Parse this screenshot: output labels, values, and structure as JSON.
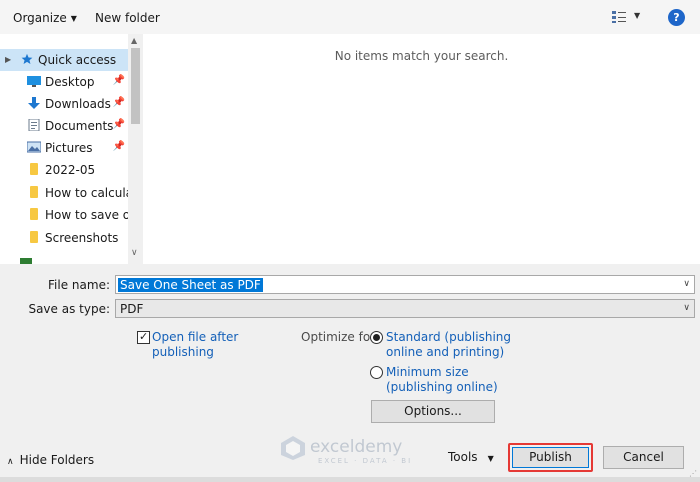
{
  "toolbar": {
    "organize_label": "Organize",
    "new_folder_label": "New folder",
    "help_label": "?"
  },
  "nav": {
    "items": [
      {
        "label": "Quick access",
        "icon": "star-icon"
      },
      {
        "label": "Desktop",
        "icon": "desktop-icon"
      },
      {
        "label": "Downloads",
        "icon": "download-arrow-icon"
      },
      {
        "label": "Documents",
        "icon": "documents-icon"
      },
      {
        "label": "Pictures",
        "icon": "pictures-icon"
      },
      {
        "label": "2022-05",
        "icon": "folder-icon"
      },
      {
        "label": "How to calculate",
        "icon": "folder-icon"
      },
      {
        "label": "How to save one",
        "icon": "folder-icon"
      },
      {
        "label": "Screenshots",
        "icon": "folder-icon"
      }
    ]
  },
  "content": {
    "empty_message": "No items match your search."
  },
  "form": {
    "file_name_label": "File name:",
    "file_name_value": "Save One Sheet as PDF",
    "save_type_label": "Save as type:",
    "save_type_value": "PDF",
    "open_after_line1": "Open file after",
    "open_after_line2": "publishing",
    "open_after_checked": true,
    "optimize_label": "Optimize for:",
    "standard_line1": "Standard (publishing",
    "standard_line2": "online and printing)",
    "minimum_line1": "Minimum size",
    "minimum_line2": "(publishing online)",
    "options_label": "Options..."
  },
  "footer": {
    "hide_folders_label": "Hide Folders",
    "tools_label": "Tools",
    "publish_label": "Publish",
    "cancel_label": "Cancel"
  },
  "watermark": {
    "name": "exceldemy",
    "tagline": "EXCEL · DATA · BI"
  },
  "colors": {
    "accent": "#0078d7",
    "link": "#1460b8",
    "highlight": "#e53935"
  }
}
